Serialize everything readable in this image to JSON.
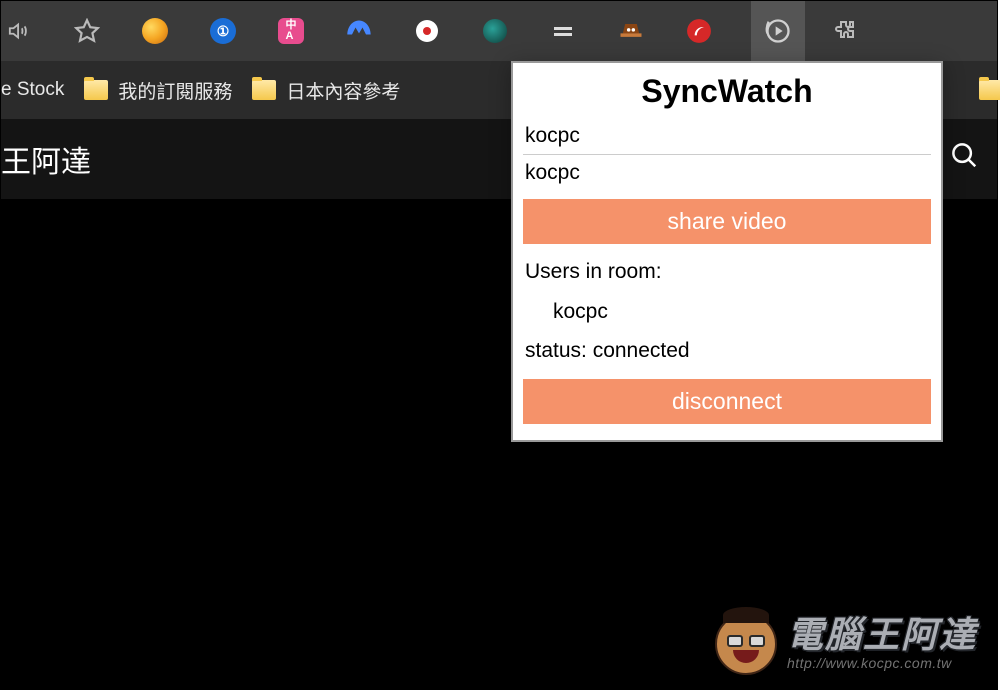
{
  "extensions": [
    {
      "name": "speaker-icon",
      "color": "transparent"
    },
    {
      "name": "star-icon",
      "color": "transparent"
    },
    {
      "name": "ext-orange-swirl",
      "color": "#f5a623"
    },
    {
      "name": "ext-1password",
      "color": "#1a6dd6"
    },
    {
      "name": "ext-translate",
      "color": "#e84c8e"
    },
    {
      "name": "ext-nordvpn",
      "color": "#4687ff"
    },
    {
      "name": "ext-record",
      "color": "#ffffff"
    },
    {
      "name": "ext-circle-teal",
      "color": "#1a6d66"
    },
    {
      "name": "ext-lines",
      "color": "#d0d0d0"
    },
    {
      "name": "ext-hat",
      "color": "#c97a3a"
    },
    {
      "name": "ext-trend",
      "color": "#d62828"
    },
    {
      "name": "ext-syncwatch",
      "color": "#d0d0d0",
      "active": true
    },
    {
      "name": "ext-puzzle",
      "color": "transparent"
    }
  ],
  "bookmarks": {
    "item0": "e Stock",
    "item1": "我的訂閱服務",
    "item2": "日本內容參考"
  },
  "page": {
    "title": "王阿達"
  },
  "popup": {
    "title": "SyncWatch",
    "name_value": "kocpc",
    "room_value": "kocpc",
    "share_button": "share video",
    "users_label": "Users in room:",
    "user_0": "kocpc",
    "status_text": "status: connected",
    "disconnect_button": "disconnect"
  },
  "watermark": {
    "title": "電腦王阿達",
    "url": "http://www.kocpc.com.tw"
  }
}
